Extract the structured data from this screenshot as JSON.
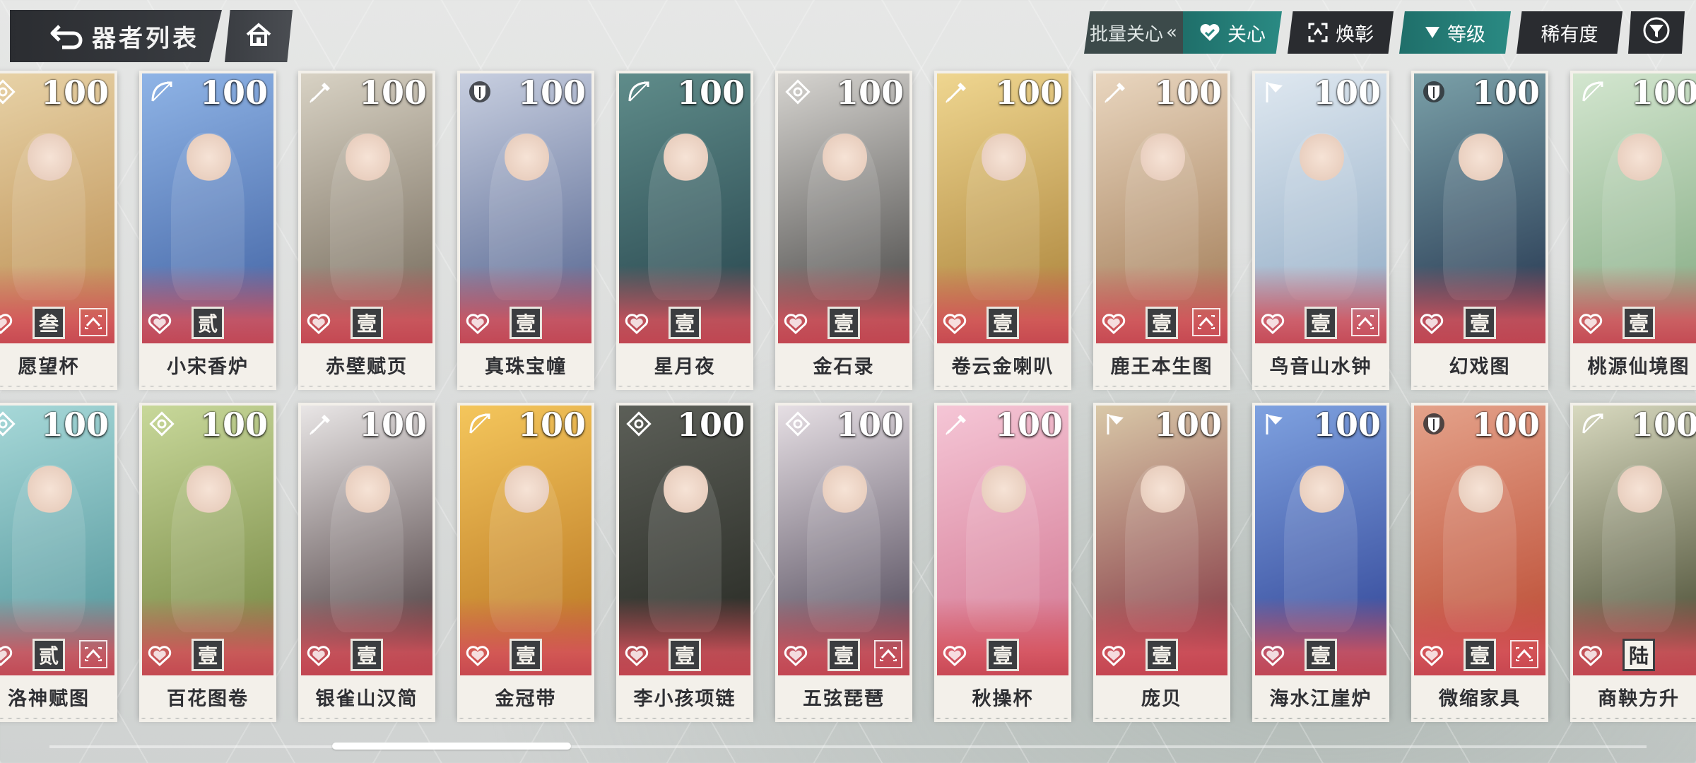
{
  "header": {
    "title": "器者列表",
    "batch_care_label": "批量关心",
    "chevrons": "«",
    "care_label": "关心",
    "display_label": "焕彰",
    "sort_label": "等级",
    "rarity_label": "稀有度"
  },
  "colors": {
    "teal": "#2a8a83",
    "dark": "#2a2c30",
    "plate": "#f3f0ea",
    "badge": "#3b3d40"
  },
  "rows": [
    [
      {
        "name": "愿望杯",
        "level": "100",
        "rank": "叁",
        "class_icon": "knot-icon",
        "awaken": true,
        "c1": "#e8d3a8",
        "c2": "#b98a4c"
      },
      {
        "name": "小宋香炉",
        "level": "100",
        "rank": "贰",
        "class_icon": "bow-icon",
        "awaken": false,
        "c1": "#8fb4e6",
        "c2": "#3e5fa0"
      },
      {
        "name": "赤壁赋页",
        "level": "100",
        "rank": "壹",
        "class_icon": "brush-icon",
        "awaken": false,
        "c1": "#d8d2c4",
        "c2": "#6d6253"
      },
      {
        "name": "真珠宝幢",
        "level": "100",
        "rank": "壹",
        "class_icon": "shield-icon",
        "awaken": false,
        "c1": "#c8cfe0",
        "c2": "#4c5d8a"
      },
      {
        "name": "星月夜",
        "level": "100",
        "rank": "壹",
        "class_icon": "bow-icon",
        "awaken": false,
        "c1": "#5f8c8a",
        "c2": "#24414a"
      },
      {
        "name": "金石录",
        "level": "100",
        "rank": "壹",
        "class_icon": "knot-icon",
        "awaken": false,
        "c1": "#d6d4d0",
        "c2": "#3d3c3b"
      },
      {
        "name": "卷云金喇叭",
        "level": "100",
        "rank": "壹",
        "class_icon": "brush-icon",
        "awaken": false,
        "c1": "#efd690",
        "c2": "#a67d34"
      },
      {
        "name": "鹿王本生图",
        "level": "100",
        "rank": "壹",
        "class_icon": "brush-icon",
        "awaken": true,
        "c1": "#e9d6bf",
        "c2": "#9d7650"
      },
      {
        "name": "鸟音山水钟",
        "level": "100",
        "rank": "壹",
        "class_icon": "flag-icon",
        "awaken": true,
        "c1": "#dfe8f0",
        "c2": "#8ba7c2"
      },
      {
        "name": "幻戏图",
        "level": "100",
        "rank": "壹",
        "class_icon": "shield-icon",
        "awaken": false,
        "c1": "#7aa0a8",
        "c2": "#1f2f4a"
      },
      {
        "name": "桃源仙境图",
        "level": "100",
        "rank": "壹",
        "class_icon": "bow-icon",
        "awaken": false,
        "c1": "#d3e6cf",
        "c2": "#7fa77e"
      }
    ],
    [
      {
        "name": "洛神赋图",
        "level": "100",
        "rank": "贰",
        "class_icon": "knot-icon",
        "awaken": true,
        "c1": "#a8d9d9",
        "c2": "#4a8f95"
      },
      {
        "name": "百花图卷",
        "level": "100",
        "rank": "壹",
        "class_icon": "knot-icon",
        "awaken": false,
        "c1": "#c8d89a",
        "c2": "#6e7f3a"
      },
      {
        "name": "银雀山汉简",
        "level": "100",
        "rank": "壹",
        "class_icon": "brush-icon",
        "awaken": false,
        "c1": "#e9e6e6",
        "c2": "#3a2a2c"
      },
      {
        "name": "金冠带",
        "level": "100",
        "rank": "壹",
        "class_icon": "bow-icon",
        "awaken": false,
        "c1": "#f4c65c",
        "c2": "#b5701e"
      },
      {
        "name": "李小孩项链",
        "level": "100",
        "rank": "壹",
        "class_icon": "knot-icon",
        "awaken": false,
        "c1": "#5c5f58",
        "c2": "#23251f"
      },
      {
        "name": "五弦琵琶",
        "level": "100",
        "rank": "壹",
        "class_icon": "knot-icon",
        "awaken": true,
        "c1": "#e6dfe4",
        "c2": "#40384a"
      },
      {
        "name": "秋操杯",
        "level": "100",
        "rank": "壹",
        "class_icon": "brush-icon",
        "awaken": false,
        "c1": "#f5c6d6",
        "c2": "#d0708c"
      },
      {
        "name": "庞贝",
        "level": "100",
        "rank": "壹",
        "class_icon": "flag-icon",
        "awaken": false,
        "c1": "#d9c8a8",
        "c2": "#7c2a3a"
      },
      {
        "name": "海水江崖炉",
        "level": "100",
        "rank": "壹",
        "class_icon": "flag-icon",
        "awaken": false,
        "c1": "#7fa2e0",
        "c2": "#2c3f92"
      },
      {
        "name": "微缩家具",
        "level": "100",
        "rank": "壹",
        "class_icon": "shield-icon",
        "awaken": true,
        "c1": "#e4a28a",
        "c2": "#b8442c"
      },
      {
        "name": "商鞅方升",
        "level": "100",
        "rank": "陆",
        "class_icon": "bow-icon",
        "awaken": false,
        "rank_white": true,
        "c1": "#d8d9bf",
        "c2": "#3a3d24"
      }
    ]
  ]
}
